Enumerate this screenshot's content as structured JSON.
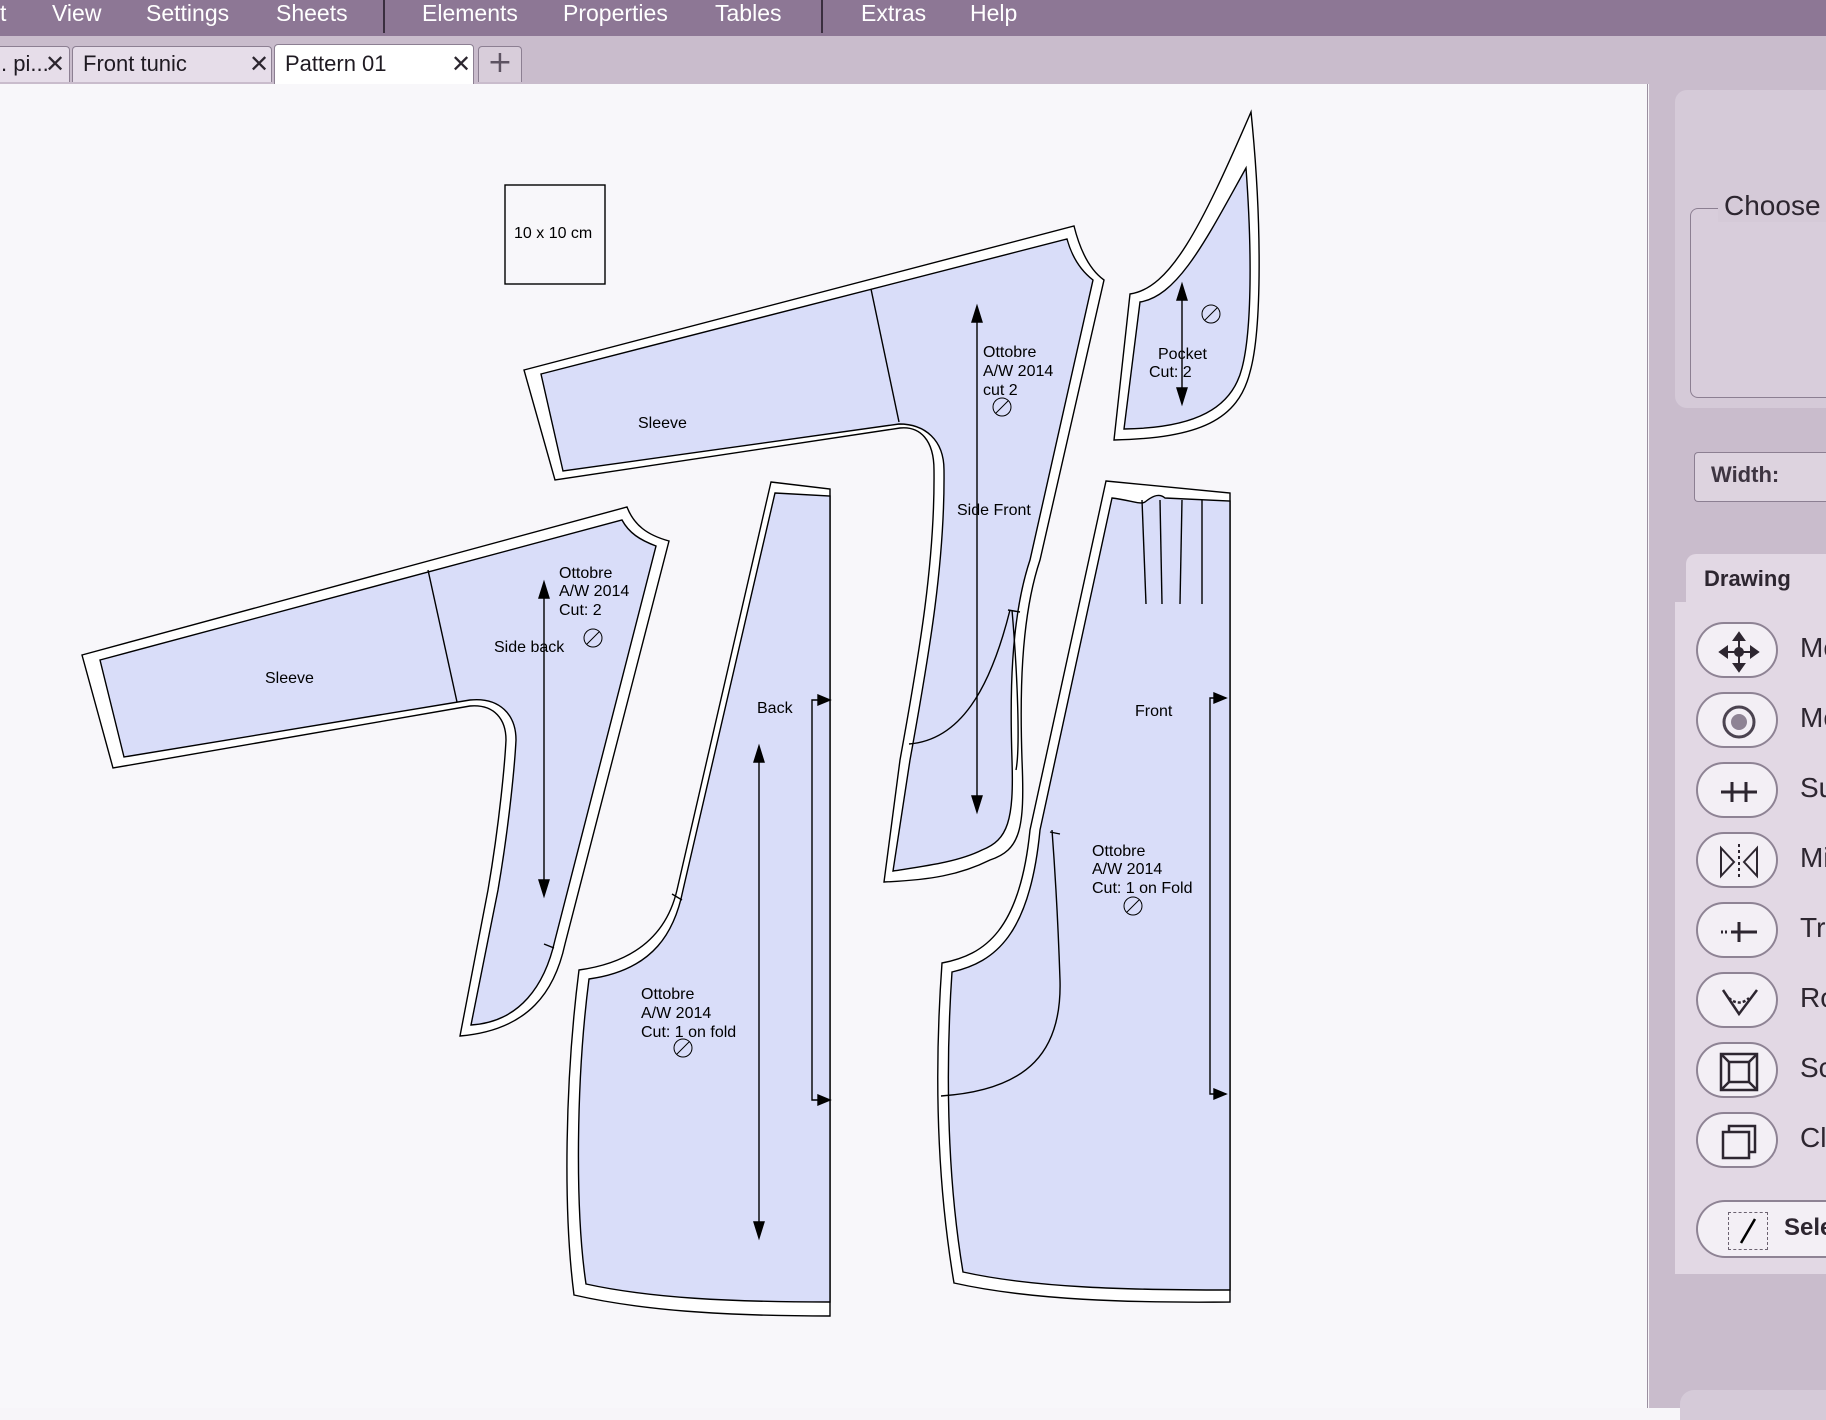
{
  "menu": {
    "items": [
      "t",
      "View",
      "Settings",
      "Sheets",
      "Elements",
      "Properties",
      "Tables",
      "Extras",
      "Help"
    ]
  },
  "tabs": {
    "items": [
      {
        "label": ". pi..."
      },
      {
        "label": "Front tunic"
      },
      {
        "label": "Pattern 01"
      }
    ],
    "add_symbol": "+",
    "close_symbol": "✕"
  },
  "canvas": {
    "square_label": "10 x 10 cm",
    "pieces": {
      "sleeve_top": "Sleeve",
      "side_front": {
        "lines": [
          "Ottobre",
          "A/W 2014",
          "cut 2"
        ],
        "name": "Side Front"
      },
      "pocket": {
        "lines": [
          "Pocket",
          "Cut: 2"
        ]
      },
      "sleeve_left": "Sleeve",
      "side_back": {
        "lines": [
          "Ottobre",
          "A/W 2014",
          "Cut: 2"
        ],
        "name": "Side back"
      },
      "back": {
        "name": "Back",
        "lines": [
          "Ottobre",
          "A/W 2014",
          "Cut: 1 on fold"
        ]
      },
      "front": {
        "name": "Front",
        "lines": [
          "Ottobre",
          "A/W 2014",
          "Cut: 1 on Fold"
        ]
      }
    }
  },
  "right_panel": {
    "choose_label": "Choose",
    "width_label": "Width:",
    "drawing_tab": "Drawing",
    "tools": [
      {
        "label": "Mo",
        "icon": "move-icon"
      },
      {
        "label": "Mo",
        "icon": "circle-icon"
      },
      {
        "label": "Su",
        "icon": "cross-line-icon"
      },
      {
        "label": "Mi",
        "icon": "mirror-icon"
      },
      {
        "label": "Tr",
        "icon": "truncate-icon"
      },
      {
        "label": "Ro",
        "icon": "rotate-icon"
      },
      {
        "label": "Sc",
        "icon": "scale-icon"
      },
      {
        "label": "Cl",
        "icon": "clone-icon"
      }
    ],
    "select_label": "Sele"
  },
  "colors": {
    "menubar": "#8d7795",
    "piece_fill": "#d9ddf9",
    "canvas": "#f8f7fa"
  }
}
